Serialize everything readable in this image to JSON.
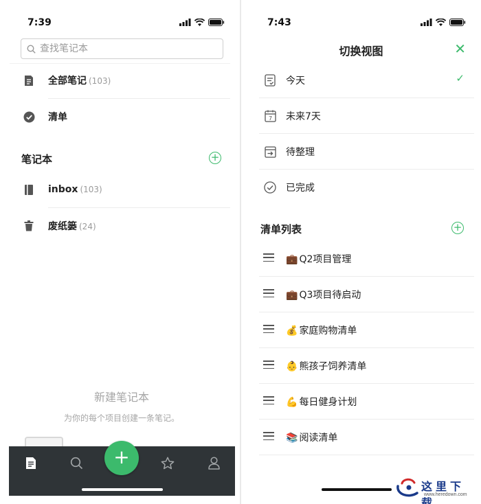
{
  "left_screen": {
    "status": {
      "time": "7:39"
    },
    "search": {
      "placeholder": "查找笔记本"
    },
    "all_notes": {
      "label": "全部笔记",
      "count": "(103)"
    },
    "checklist": {
      "label": "清单"
    },
    "notebooks_section": {
      "title": "笔记本"
    },
    "notebooks": [
      {
        "label": "inbox",
        "count": "(103)"
      },
      {
        "label": "废纸篓",
        "count": "(24)"
      }
    ],
    "empty_state": {
      "title": "新建笔记本",
      "subtitle": "为你的每个项目创建一条笔记。"
    },
    "tabbar": {
      "tabs": [
        {
          "icon": "notes-icon",
          "active": true
        },
        {
          "icon": "search-icon",
          "active": false
        },
        {
          "icon": "add-icon",
          "active": false
        },
        {
          "icon": "star-icon",
          "active": false
        },
        {
          "icon": "profile-icon",
          "active": false
        }
      ],
      "fab_label": "+"
    }
  },
  "right_screen": {
    "status": {
      "time": "7:43"
    },
    "nav": {
      "title": "切换视图",
      "close": "✕"
    },
    "views": [
      {
        "label": "今天",
        "icon": "today-icon",
        "checked": true
      },
      {
        "label": "未来7天",
        "icon": "calendar-7-icon",
        "checked": false
      },
      {
        "label": "待整理",
        "icon": "inbox-arrow-icon",
        "checked": false
      },
      {
        "label": "已完成",
        "icon": "check-circle-icon",
        "checked": false
      }
    ],
    "lists_section": {
      "title": "清单列表"
    },
    "lists": [
      {
        "emoji": "💼",
        "label": "Q2项目管理"
      },
      {
        "emoji": "💼",
        "label": "Q3项目待启动"
      },
      {
        "emoji": "💰",
        "label": "家庭购物清单"
      },
      {
        "emoji": "👶",
        "label": "熊孩子饲养清单"
      },
      {
        "emoji": "💪",
        "label": "每日健身计划"
      },
      {
        "emoji": "📚",
        "label": "阅读清单"
      }
    ]
  },
  "watermark": {
    "text": "这里下载",
    "url": "www.heredown.com"
  },
  "colors": {
    "accent": "#3cba6c",
    "tabbar": "#2f3437",
    "separator": "#ececec",
    "muted": "#9a9a9a"
  }
}
